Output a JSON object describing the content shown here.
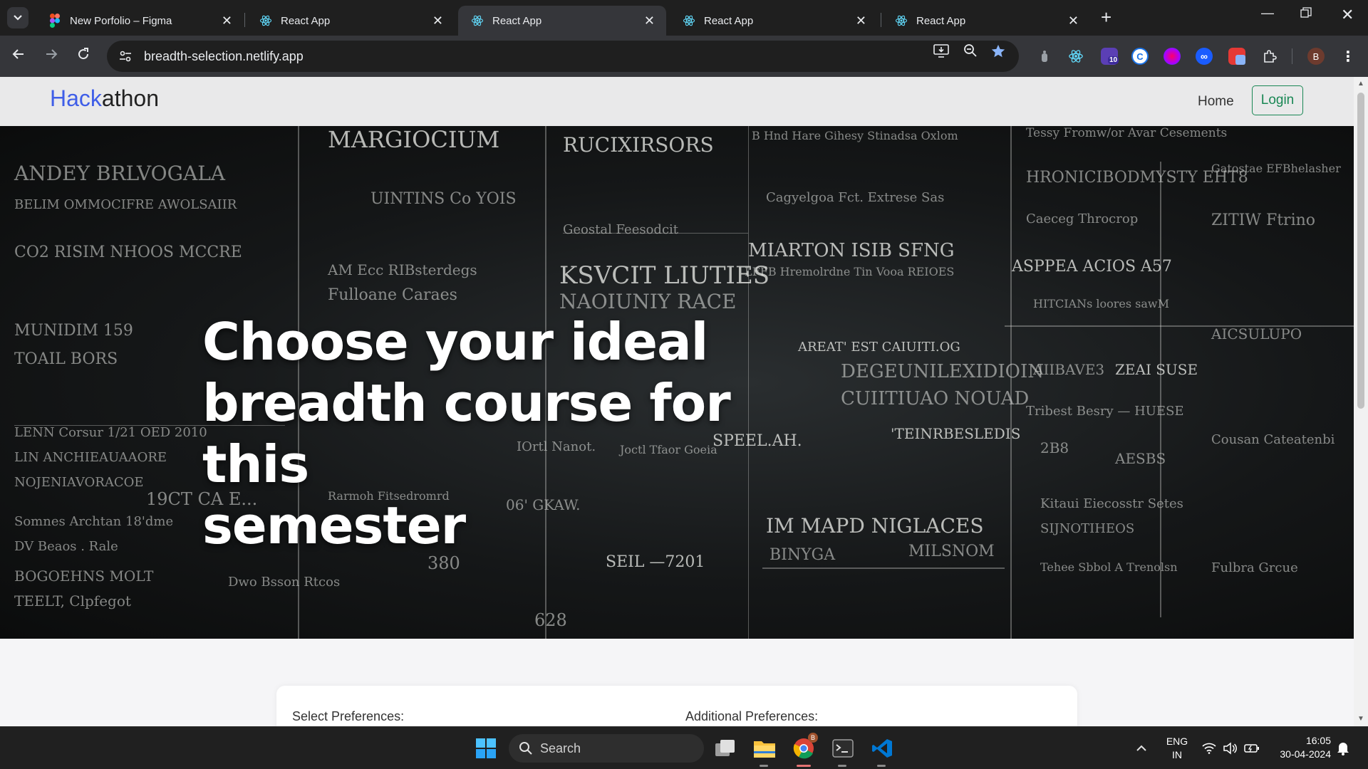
{
  "browser": {
    "tabs": [
      {
        "title": "New Porfolio – Figma",
        "icon": "figma-icon",
        "active": false
      },
      {
        "title": "React App",
        "icon": "react-icon",
        "active": false
      },
      {
        "title": "React App",
        "icon": "react-icon",
        "active": true
      },
      {
        "title": "React App",
        "icon": "react-icon",
        "active": false
      },
      {
        "title": "React App",
        "icon": "react-icon",
        "active": false
      }
    ],
    "new_tab_label": "+",
    "url": "breadth-selection.netlify.app",
    "extensions": [
      {
        "name": "puzzle-icon"
      },
      {
        "name": "react-devtools-icon"
      },
      {
        "name": "badge-extension-icon",
        "badge": "10"
      },
      {
        "name": "c-extension-icon",
        "letter": "C"
      },
      {
        "name": "brain-extension-icon"
      },
      {
        "name": "infinity-extension-icon"
      },
      {
        "name": "red-extension-icon"
      },
      {
        "name": "extensions-puzzle-icon"
      }
    ],
    "profile_initial": "B"
  },
  "page": {
    "brand": {
      "accent": "Hack",
      "rest": "athon"
    },
    "nav": {
      "home": "Home",
      "login": "Login"
    },
    "hero": {
      "title_line1": "Choose your ideal",
      "title_line2": "breadth course for this",
      "title_line3": "semester"
    },
    "preferences": {
      "select_label": "Select Preferences:",
      "additional_label": "Additional Preferences:"
    },
    "colors": {
      "brand_accent": "#3f5ee8",
      "login_green": "#198754"
    }
  },
  "taskbar": {
    "search_placeholder": "Search",
    "language_line1": "ENG",
    "language_line2": "IN",
    "time": "16:05",
    "date": "30-04-2024",
    "chrome_badge": "B"
  }
}
